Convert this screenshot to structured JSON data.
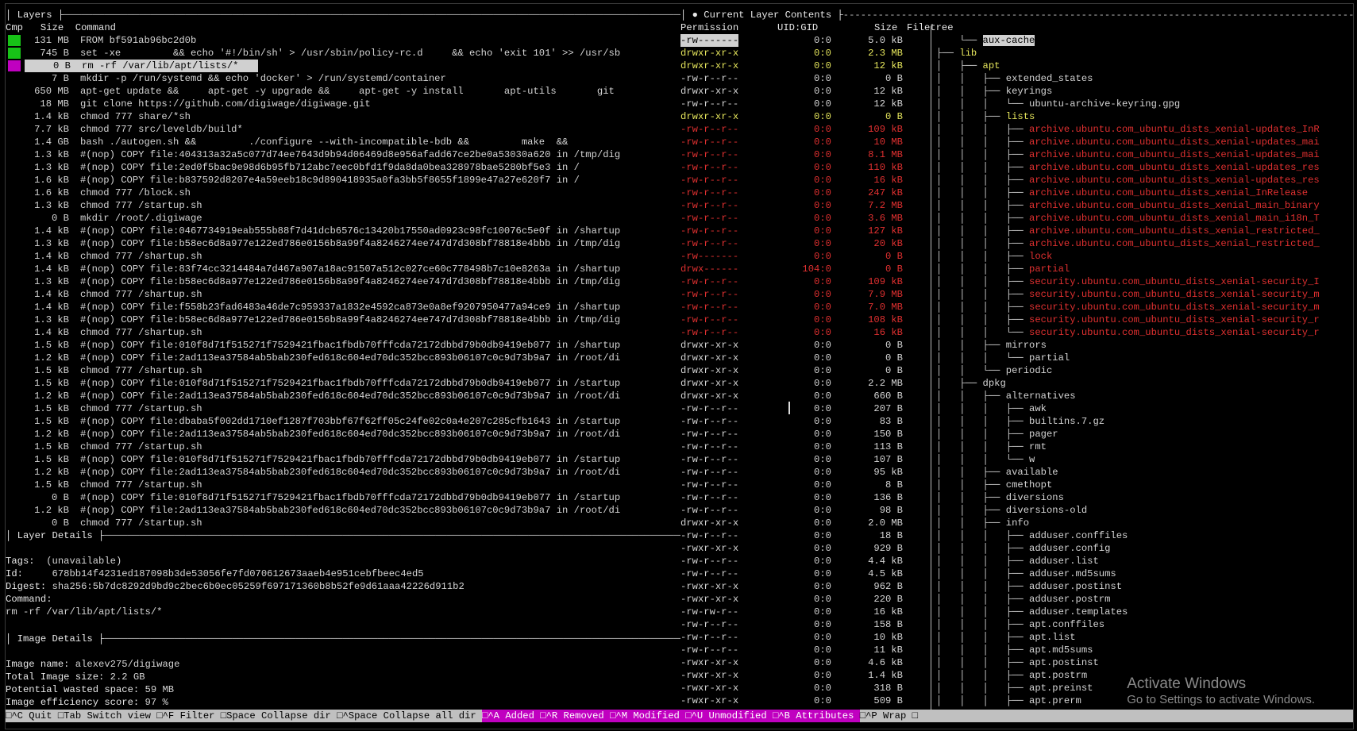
{
  "layers_panel": {
    "title": "│ Layers ├",
    "header": "Cmp   Size  Command",
    "rows": [
      {
        "size": "131 MB",
        "cmd": "FROM bf591ab96bc2d0b",
        "cmp": "green"
      },
      {
        "size": "745 B",
        "cmd": "set -xe         && echo '#!/bin/sh' > /usr/sbin/policy-rc.d     && echo 'exit 101' >> /usr/sb",
        "cmp": "green"
      },
      {
        "size": "0 B",
        "cmd": "rm -rf /var/lib/apt/lists/*",
        "cmp": "magenta",
        "selected": true
      },
      {
        "size": "7 B",
        "cmd": "mkdir -p /run/systemd && echo 'docker' > /run/systemd/container"
      },
      {
        "size": "650 MB",
        "cmd": "apt-get update &&     apt-get -y upgrade &&     apt-get -y install       apt-utils       git"
      },
      {
        "size": "18 MB",
        "cmd": "git clone https://github.com/digiwage/digiwage.git"
      },
      {
        "size": "1.4 kB",
        "cmd": "chmod 777 share/*sh"
      },
      {
        "size": "7.7 kB",
        "cmd": "chmod 777 src/leveldb/build*"
      },
      {
        "size": "1.4 GB",
        "cmd": "bash ./autogen.sh &&         ./configure --with-incompatible-bdb &&         make  &&"
      },
      {
        "size": "1.3 kB",
        "cmd": "#(nop) COPY file:404313a32a5c077d74ee7643d9b94d06469d8e956afadd67ce2be0a53030a620 in /tmp/dig"
      },
      {
        "size": "1.3 kB",
        "cmd": "#(nop) COPY file:2ed0f5bac9e98d6b95fb712abc7eec0bfd1f9da8da0bea328978bae5280bf5e3 in /"
      },
      {
        "size": "1.6 kB",
        "cmd": "#(nop) COPY file:b837592d8207e4a59eeb18c9d890418935a0fa3bb5f8655f1899e47a27e620f7 in /"
      },
      {
        "size": "1.6 kB",
        "cmd": "chmod 777 /block.sh"
      },
      {
        "size": "1.3 kB",
        "cmd": "chmod 777 /startup.sh"
      },
      {
        "size": "0 B",
        "cmd": "mkdir /root/.digiwage"
      },
      {
        "size": "1.4 kB",
        "cmd": "#(nop) COPY file:0467734919eab555b88f7d41dcb6576c13420b17550ad0923c98fc10076c5e0f in /shartup"
      },
      {
        "size": "1.3 kB",
        "cmd": "#(nop) COPY file:b58ec6d8a977e122ed786e0156b8a99f4a8246274ee747d7d308bf78818e4bbb in /tmp/dig"
      },
      {
        "size": "1.4 kB",
        "cmd": "chmod 777 /shartup.sh"
      },
      {
        "size": "1.4 kB",
        "cmd": "#(nop) COPY file:83f74cc3214484a7d467a907a18ac91507a512c027ce60c778498b7c10e8263a in /shartup"
      },
      {
        "size": "1.3 kB",
        "cmd": "#(nop) COPY file:b58ec6d8a977e122ed786e0156b8a99f4a8246274ee747d7d308bf78818e4bbb in /tmp/dig"
      },
      {
        "size": "1.4 kB",
        "cmd": "chmod 777 /shartup.sh"
      },
      {
        "size": "1.4 kB",
        "cmd": "#(nop) COPY file:f558b23fad6483a46de7c959337a1832e4592ca873e0a8ef9207950477a94ce9 in /shartup"
      },
      {
        "size": "1.3 kB",
        "cmd": "#(nop) COPY file:b58ec6d8a977e122ed786e0156b8a99f4a8246274ee747d7d308bf78818e4bbb in /tmp/dig"
      },
      {
        "size": "1.4 kB",
        "cmd": "chmod 777 /shartup.sh"
      },
      {
        "size": "1.5 kB",
        "cmd": "#(nop) COPY file:010f8d71f515271f7529421fbac1fbdb70fffcda72172dbbd79b0db9419eb077 in /shartup"
      },
      {
        "size": "1.2 kB",
        "cmd": "#(nop) COPY file:2ad113ea37584ab5bab230fed618c604ed70dc352bcc893b06107c0c9d73b9a7 in /root/di"
      },
      {
        "size": "1.5 kB",
        "cmd": "chmod 777 /shartup.sh"
      },
      {
        "size": "1.5 kB",
        "cmd": "#(nop) COPY file:010f8d71f515271f7529421fbac1fbdb70fffcda72172dbbd79b0db9419eb077 in /startup"
      },
      {
        "size": "1.2 kB",
        "cmd": "#(nop) COPY file:2ad113ea37584ab5bab230fed618c604ed70dc352bcc893b06107c0c9d73b9a7 in /root/di"
      },
      {
        "size": "1.5 kB",
        "cmd": "chmod 777 /startup.sh"
      },
      {
        "size": "1.5 kB",
        "cmd": "#(nop) COPY file:dbaba5f002dd1710ef1287f703bbf67f62ff05c24fe02c0a4e207c285cfb1643 in /startup"
      },
      {
        "size": "1.2 kB",
        "cmd": "#(nop) COPY file:2ad113ea37584ab5bab230fed618c604ed70dc352bcc893b06107c0c9d73b9a7 in /root/di"
      },
      {
        "size": "1.5 kB",
        "cmd": "chmod 777 /startup.sh"
      },
      {
        "size": "1.5 kB",
        "cmd": "#(nop) COPY file:010f8d71f515271f7529421fbac1fbdb70fffcda72172dbbd79b0db9419eb077 in /startup"
      },
      {
        "size": "1.2 kB",
        "cmd": "#(nop) COPY file:2ad113ea37584ab5bab230fed618c604ed70dc352bcc893b06107c0c9d73b9a7 in /root/di"
      },
      {
        "size": "1.5 kB",
        "cmd": "chmod 777 /startup.sh"
      },
      {
        "size": "0 B",
        "cmd": "#(nop) COPY file:010f8d71f515271f7529421fbac1fbdb70fffcda72172dbbd79b0db9419eb077 in /startup"
      },
      {
        "size": "1.2 kB",
        "cmd": "#(nop) COPY file:2ad113ea37584ab5bab230fed618c604ed70dc352bcc893b06107c0c9d73b9a7 in /root/di"
      },
      {
        "size": "0 B",
        "cmd": "chmod 777 /startup.sh"
      }
    ]
  },
  "layer_details": {
    "title": "│ Layer Details ├",
    "tags_label": "Tags:",
    "tags_value": "(unavailable)",
    "id_label": "Id:",
    "id_value": "678bb14f4231ed187098b3de53056fe7fd070612673aaeb4e951cebfbeec4ed5",
    "digest_label": "Digest:",
    "digest_value": "sha256:5b7dc8292d9bd9c2bec6b0ec05259f697171360b8b52fe9d61aaa42226d911b2",
    "command_label": "Command:",
    "command_value": "rm -rf /var/lib/apt/lists/*"
  },
  "image_details": {
    "title": "│ Image Details ├",
    "name_label": "Image name:",
    "name_value": "alexev275/digiwage",
    "size_label": "Total Image size:",
    "size_value": "2.2 GB",
    "wasted_label": "Potential wasted space:",
    "wasted_value": "59 MB",
    "eff_label": "Image efficiency score:",
    "eff_value": "97 %"
  },
  "contents_panel": {
    "title": "│ ● Current Layer Contents ├",
    "header_perm": "Permission",
    "header_uid": "UID:GID",
    "header_size": "Size",
    "header_tree": "Filetree",
    "rows": [
      {
        "perm": "-rw-------",
        "uid": "0:0",
        "size": "5.0 kB",
        "tree": "    └── ",
        "name": "aux-cache",
        "style": "hl"
      },
      {
        "perm": "drwxr-xr-x",
        "uid": "0:0",
        "size": "2.3 MB",
        "tree": "├── ",
        "name": "lib",
        "style": "yellow"
      },
      {
        "perm": "drwxr-xr-x",
        "uid": "0:0",
        "size": "12 kB",
        "tree": "│   ├── ",
        "name": "apt",
        "style": "yellow"
      },
      {
        "perm": "-rw-r--r--",
        "uid": "0:0",
        "size": "0 B",
        "tree": "│   │   ├── ",
        "name": "extended_states"
      },
      {
        "perm": "drwxr-xr-x",
        "uid": "0:0",
        "size": "12 kB",
        "tree": "│   │   ├── ",
        "name": "keyrings"
      },
      {
        "perm": "-rw-r--r--",
        "uid": "0:0",
        "size": "12 kB",
        "tree": "│   │   │   └── ",
        "name": "ubuntu-archive-keyring.gpg"
      },
      {
        "perm": "drwxr-xr-x",
        "uid": "0:0",
        "size": "0 B",
        "tree": "│   │   ├── ",
        "name": "lists",
        "style": "yellow"
      },
      {
        "perm": "-rw-r--r--",
        "uid": "0:0",
        "size": "109 kB",
        "tree": "│   │   │   ├── ",
        "name": "archive.ubuntu.com_ubuntu_dists_xenial-updates_InR",
        "style": "red"
      },
      {
        "perm": "-rw-r--r--",
        "uid": "0:0",
        "size": "10 MB",
        "tree": "│   │   │   ├── ",
        "name": "archive.ubuntu.com_ubuntu_dists_xenial-updates_mai",
        "style": "red"
      },
      {
        "perm": "-rw-r--r--",
        "uid": "0:0",
        "size": "8.1 MB",
        "tree": "│   │   │   ├── ",
        "name": "archive.ubuntu.com_ubuntu_dists_xenial-updates_mai",
        "style": "red"
      },
      {
        "perm": "-rw-r--r--",
        "uid": "0:0",
        "size": "110 kB",
        "tree": "│   │   │   ├── ",
        "name": "archive.ubuntu.com_ubuntu_dists_xenial-updates_res",
        "style": "red"
      },
      {
        "perm": "-rw-r--r--",
        "uid": "0:0",
        "size": "16 kB",
        "tree": "│   │   │   ├── ",
        "name": "archive.ubuntu.com_ubuntu_dists_xenial-updates_res",
        "style": "red"
      },
      {
        "perm": "-rw-r--r--",
        "uid": "0:0",
        "size": "247 kB",
        "tree": "│   │   │   ├── ",
        "name": "archive.ubuntu.com_ubuntu_dists_xenial_InRelease",
        "style": "red"
      },
      {
        "perm": "-rw-r--r--",
        "uid": "0:0",
        "size": "7.2 MB",
        "tree": "│   │   │   ├── ",
        "name": "archive.ubuntu.com_ubuntu_dists_xenial_main_binary",
        "style": "red"
      },
      {
        "perm": "-rw-r--r--",
        "uid": "0:0",
        "size": "3.6 MB",
        "tree": "│   │   │   ├── ",
        "name": "archive.ubuntu.com_ubuntu_dists_xenial_main_i18n_T",
        "style": "red"
      },
      {
        "perm": "-rw-r--r--",
        "uid": "0:0",
        "size": "127 kB",
        "tree": "│   │   │   ├── ",
        "name": "archive.ubuntu.com_ubuntu_dists_xenial_restricted_",
        "style": "red"
      },
      {
        "perm": "-rw-r--r--",
        "uid": "0:0",
        "size": "20 kB",
        "tree": "│   │   │   ├── ",
        "name": "archive.ubuntu.com_ubuntu_dists_xenial_restricted_",
        "style": "red"
      },
      {
        "perm": "-rw-------",
        "uid": "0:0",
        "size": "0 B",
        "tree": "│   │   │   ├── ",
        "name": "lock",
        "style": "red"
      },
      {
        "perm": "drwx------",
        "uid": "104:0",
        "size": "0 B",
        "tree": "│   │   │   ├── ",
        "name": "partial",
        "style": "red"
      },
      {
        "perm": "-rw-r--r--",
        "uid": "0:0",
        "size": "109 kB",
        "tree": "│   │   │   ├── ",
        "name": "security.ubuntu.com_ubuntu_dists_xenial-security_I",
        "style": "red"
      },
      {
        "perm": "-rw-r--r--",
        "uid": "0:0",
        "size": "7.9 MB",
        "tree": "│   │   │   ├── ",
        "name": "security.ubuntu.com_ubuntu_dists_xenial-security_m",
        "style": "red"
      },
      {
        "perm": "-rw-r--r--",
        "uid": "0:0",
        "size": "7.0 MB",
        "tree": "│   │   │   ├── ",
        "name": "security.ubuntu.com_ubuntu_dists_xenial-security_m",
        "style": "red"
      },
      {
        "perm": "-rw-r--r--",
        "uid": "0:0",
        "size": "108 kB",
        "tree": "│   │   │   ├── ",
        "name": "security.ubuntu.com_ubuntu_dists_xenial-security_r",
        "style": "red"
      },
      {
        "perm": "-rw-r--r--",
        "uid": "0:0",
        "size": "16 kB",
        "tree": "│   │   │   └── ",
        "name": "security.ubuntu.com_ubuntu_dists_xenial-security_r",
        "style": "red"
      },
      {
        "perm": "drwxr-xr-x",
        "uid": "0:0",
        "size": "0 B",
        "tree": "│   │   ├── ",
        "name": "mirrors"
      },
      {
        "perm": "drwxr-xr-x",
        "uid": "0:0",
        "size": "0 B",
        "tree": "│   │   │   └── ",
        "name": "partial"
      },
      {
        "perm": "drwxr-xr-x",
        "uid": "0:0",
        "size": "0 B",
        "tree": "│   │   └── ",
        "name": "periodic"
      },
      {
        "perm": "drwxr-xr-x",
        "uid": "0:0",
        "size": "2.2 MB",
        "tree": "│   ├── ",
        "name": "dpkg"
      },
      {
        "perm": "drwxr-xr-x",
        "uid": "0:0",
        "size": "660 B",
        "tree": "│   │   ├── ",
        "name": "alternatives"
      },
      {
        "perm": "-rw-r--r--",
        "uid": "0:0",
        "size": "207 B",
        "tree": "│   │   │   ├── ",
        "name": "awk"
      },
      {
        "perm": "-rw-r--r--",
        "uid": "0:0",
        "size": "83 B",
        "tree": "│   │   │   ├── ",
        "name": "builtins.7.gz"
      },
      {
        "perm": "-rw-r--r--",
        "uid": "0:0",
        "size": "150 B",
        "tree": "│   │   │   ├── ",
        "name": "pager"
      },
      {
        "perm": "-rw-r--r--",
        "uid": "0:0",
        "size": "113 B",
        "tree": "│   │   │   ├── ",
        "name": "rmt"
      },
      {
        "perm": "-rw-r--r--",
        "uid": "0:0",
        "size": "107 B",
        "tree": "│   │   │   └── ",
        "name": "w"
      },
      {
        "perm": "-rw-r--r--",
        "uid": "0:0",
        "size": "95 kB",
        "tree": "│   │   ├── ",
        "name": "available"
      },
      {
        "perm": "-rw-r--r--",
        "uid": "0:0",
        "size": "8 B",
        "tree": "│   │   ├── ",
        "name": "cmethopt"
      },
      {
        "perm": "-rw-r--r--",
        "uid": "0:0",
        "size": "136 B",
        "tree": "│   │   ├── ",
        "name": "diversions"
      },
      {
        "perm": "-rw-r--r--",
        "uid": "0:0",
        "size": "98 B",
        "tree": "│   │   ├── ",
        "name": "diversions-old"
      },
      {
        "perm": "drwxr-xr-x",
        "uid": "0:0",
        "size": "2.0 MB",
        "tree": "│   │   ├── ",
        "name": "info"
      },
      {
        "perm": "-rw-r--r--",
        "uid": "0:0",
        "size": "18 B",
        "tree": "│   │   │   ├── ",
        "name": "adduser.conffiles"
      },
      {
        "perm": "-rwxr-xr-x",
        "uid": "0:0",
        "size": "929 B",
        "tree": "│   │   │   ├── ",
        "name": "adduser.config"
      },
      {
        "perm": "-rw-r--r--",
        "uid": "0:0",
        "size": "4.4 kB",
        "tree": "│   │   │   ├── ",
        "name": "adduser.list"
      },
      {
        "perm": "-rw-r--r--",
        "uid": "0:0",
        "size": "4.5 kB",
        "tree": "│   │   │   ├── ",
        "name": "adduser.md5sums"
      },
      {
        "perm": "-rwxr-xr-x",
        "uid": "0:0",
        "size": "962 B",
        "tree": "│   │   │   ├── ",
        "name": "adduser.postinst"
      },
      {
        "perm": "-rwxr-xr-x",
        "uid": "0:0",
        "size": "220 B",
        "tree": "│   │   │   ├── ",
        "name": "adduser.postrm"
      },
      {
        "perm": "-rw-rw-r--",
        "uid": "0:0",
        "size": "16 kB",
        "tree": "│   │   │   ├── ",
        "name": "adduser.templates"
      },
      {
        "perm": "-rw-r--r--",
        "uid": "0:0",
        "size": "158 B",
        "tree": "│   │   │   ├── ",
        "name": "apt.conffiles"
      },
      {
        "perm": "-rw-r--r--",
        "uid": "0:0",
        "size": "10 kB",
        "tree": "│   │   │   ├── ",
        "name": "apt.list"
      },
      {
        "perm": "-rw-r--r--",
        "uid": "0:0",
        "size": "11 kB",
        "tree": "│   │   │   ├── ",
        "name": "apt.md5sums"
      },
      {
        "perm": "-rwxr-xr-x",
        "uid": "0:0",
        "size": "4.6 kB",
        "tree": "│   │   │   ├── ",
        "name": "apt.postinst"
      },
      {
        "perm": "-rwxr-xr-x",
        "uid": "0:0",
        "size": "1.4 kB",
        "tree": "│   │   │   ├── ",
        "name": "apt.postrm"
      },
      {
        "perm": "-rwxr-xr-x",
        "uid": "0:0",
        "size": "318 B",
        "tree": "│   │   │   ├── ",
        "name": "apt.preinst"
      },
      {
        "perm": "-rwxr-xr-x",
        "uid": "0:0",
        "size": "509 B",
        "tree": "│   │   │   ├── ",
        "name": "apt.prerm"
      }
    ]
  },
  "footer": {
    "items": [
      {
        "key": "^C",
        "label": "Quit"
      },
      {
        "key": "Tab",
        "label": "Switch view"
      },
      {
        "key": "^F",
        "label": "Filter"
      },
      {
        "key": "Space",
        "label": "Collapse dir"
      },
      {
        "key": "^Space",
        "label": "Collapse all dir"
      },
      {
        "key": "^A",
        "label": "Added",
        "active": true
      },
      {
        "key": "^R",
        "label": "Removed",
        "active": true
      },
      {
        "key": "^M",
        "label": "Modified",
        "active": true
      },
      {
        "key": "^U",
        "label": "Unmodified",
        "active": true
      },
      {
        "key": "^B",
        "label": "Attributes",
        "active": true
      },
      {
        "key": "^P",
        "label": "Wrap"
      }
    ]
  },
  "watermark": {
    "line1": "Activate Windows",
    "line2": "Go to Settings to activate Windows."
  },
  "colors": {
    "green": "#17c217",
    "magenta": "#c000c0",
    "yellow": "#e5e55c",
    "red": "#e03030"
  }
}
